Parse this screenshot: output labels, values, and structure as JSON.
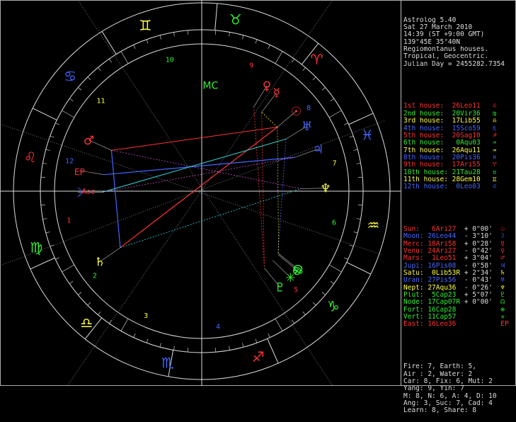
{
  "header": [
    "Astrolog 5.40",
    "Sat 27 March 2010",
    "14:39 (ST +9:00 GMT)",
    "139°45E 35°40N",
    "Regiomontanus houses.",
    "Tropical, Geocentric.",
    "Julian Day = 2455282.7354"
  ],
  "houses": [
    {
      "label": "1st house:",
      "value": "26Leo11",
      "color": "#ff3333",
      "glyph": "♌"
    },
    {
      "label": "2nd house:",
      "value": "20Vir36",
      "color": "#33ee33",
      "glyph": "♍"
    },
    {
      "label": "3rd house:",
      "value": "17Lib55",
      "color": "#ffff44",
      "glyph": "♎"
    },
    {
      "label": "4th house:",
      "value": "15Sco59",
      "color": "#4466ff",
      "glyph": "♏"
    },
    {
      "label": "5th house:",
      "value": "20Sag10",
      "color": "#ff3333",
      "glyph": "♐"
    },
    {
      "label": "6th house:",
      "value": " 0Aqu03",
      "color": "#33ee33",
      "glyph": "♒"
    },
    {
      "label": "7th house:",
      "value": "26Aqu11",
      "color": "#ffff44",
      "glyph": "♒"
    },
    {
      "label": "8th house:",
      "value": "20Pis36",
      "color": "#4466ff",
      "glyph": "♓"
    },
    {
      "label": "9th house:",
      "value": "17Ari55",
      "color": "#ff3333",
      "glyph": "♈"
    },
    {
      "label": "10th house:",
      "value": "21Tau28",
      "color": "#33ee33",
      "glyph": "♉"
    },
    {
      "label": "11th house:",
      "value": "28Gem10",
      "color": "#ffff44",
      "glyph": "♊"
    },
    {
      "label": "12th house:",
      "value": " 0Leo03",
      "color": "#4466ff",
      "glyph": "♌"
    }
  ],
  "planets": [
    {
      "label": "Sun:",
      "value": " 6Ari27",
      "speed": "+ 0°00'",
      "color": "#ff3333",
      "glyph": "☉"
    },
    {
      "label": "Moon:",
      "value": "26Leo44",
      "speed": "- 3°10'",
      "color": "#4466ff",
      "glyph": "☽"
    },
    {
      "label": "Merc:",
      "value": "18Ari58",
      "speed": "+ 0°28'",
      "color": "#ff3333",
      "glyph": "☿"
    },
    {
      "label": "Venu:",
      "value": "24Ari27",
      "speed": "- 0°42'",
      "color": "#ff3333",
      "glyph": "♀"
    },
    {
      "label": "Mars:",
      "value": " 1Leo51",
      "speed": "+ 3°04'",
      "color": "#ff3333",
      "glyph": "♂"
    },
    {
      "label": "Jupi:",
      "value": "16Pis08",
      "speed": "- 0°58'",
      "color": "#4466ff",
      "glyph": "♃"
    },
    {
      "label": "Satu:",
      "value": " 0Lib53R",
      "speed": "+ 2°34'",
      "color": "#ffff44",
      "glyph": "♄"
    },
    {
      "label": "Uran:",
      "value": "27Pis56",
      "speed": "- 0°43'",
      "color": "#4466ff",
      "glyph": "♅"
    },
    {
      "label": "Nept:",
      "value": "27Aqu36",
      "speed": "- 0°26'",
      "color": "#ffff44",
      "glyph": "♆"
    },
    {
      "label": "Plut:",
      "value": " 5Cap23",
      "speed": "+ 5°07'",
      "color": "#33ee33",
      "glyph": "♇"
    },
    {
      "label": "Node:",
      "value": "17Cap07R",
      "speed": "+ 0°00'",
      "color": "#33ee33",
      "glyph": "☊"
    },
    {
      "label": "Fort:",
      "value": "16Cap28",
      "speed": "",
      "color": "#33ee33",
      "glyph": "⊗"
    },
    {
      "label": "Vert:",
      "value": "11Cap57",
      "speed": "",
      "color": "#33ee33",
      "glyph": "✳"
    },
    {
      "label": "East:",
      "value": "16Leo36",
      "speed": "",
      "color": "#ff3333",
      "glyph": "EP"
    }
  ],
  "stats": [
    "Fire: 7, Earth: 5,",
    "Air : 2, Water: 2",
    "Car: 8, Fix: 6, Mut: 2",
    "Yang: 9, Yin: 7",
    "M: 8, N: 6, A: 4, D: 10",
    "Ang: 3, Suc: 7, Cad: 4",
    "Learn: 8, Share: 8"
  ],
  "signs": [
    {
      "glyph": "♈",
      "color": "#ff3333"
    },
    {
      "glyph": "♉",
      "color": "#33ee33"
    },
    {
      "glyph": "♊",
      "color": "#ffff44"
    },
    {
      "glyph": "♋",
      "color": "#4466ff"
    },
    {
      "glyph": "♌",
      "color": "#ff3333"
    },
    {
      "glyph": "♍",
      "color": "#33ee33"
    },
    {
      "glyph": "♎",
      "color": "#ffff44"
    },
    {
      "glyph": "♏",
      "color": "#4466ff"
    },
    {
      "glyph": "♐",
      "color": "#ff3333"
    },
    {
      "glyph": "♑",
      "color": "#33ee33"
    },
    {
      "glyph": "♒",
      "color": "#ffff44"
    },
    {
      "glyph": "♓",
      "color": "#4466ff"
    }
  ],
  "house_numbers": [
    {
      "n": "1",
      "color": "#ff3333"
    },
    {
      "n": "2",
      "color": "#33ee33"
    },
    {
      "n": "3",
      "color": "#ffff44"
    },
    {
      "n": "4",
      "color": "#4466ff"
    },
    {
      "n": "5",
      "color": "#ff3333"
    },
    {
      "n": "6",
      "color": "#33ee33"
    },
    {
      "n": "7",
      "color": "#ffff44"
    },
    {
      "n": "8",
      "color": "#4466ff"
    },
    {
      "n": "9",
      "color": "#ff3333"
    },
    {
      "n": "10",
      "color": "#33ee33"
    },
    {
      "n": "11",
      "color": "#ffff44"
    },
    {
      "n": "12",
      "color": "#4466ff"
    }
  ],
  "angle_labels": {
    "asc": "Asc",
    "mc": "MC",
    "ep": "EP"
  }
}
